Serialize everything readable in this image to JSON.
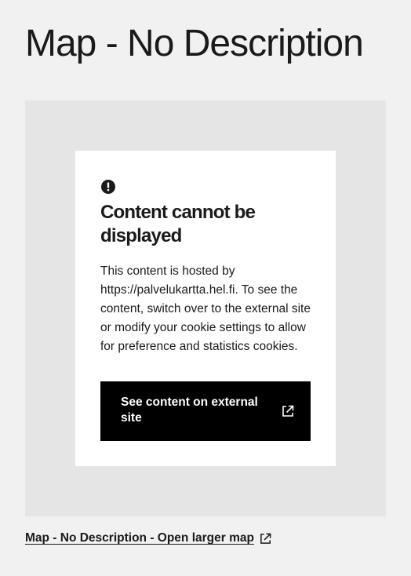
{
  "page": {
    "title": "Map - No Description"
  },
  "embed_notice": {
    "icon": "alert-circle-icon",
    "heading": "Content cannot be displayed",
    "body": "This content is hosted by https://palvelukartta.hel.fi. To see the content, switch over to the external site or modify your cookie settings to allow for preference and statistics cookies.",
    "button_label": "See content on external site",
    "button_icon": "external-link-icon"
  },
  "larger_map_link": {
    "label": "Map - No Description - Open larger map",
    "icon": "external-link-icon"
  },
  "colors": {
    "page_background": "#f1f1f1",
    "frame_background": "#e5e5e5",
    "card_background": "#ffffff",
    "button_background": "#000000",
    "text": "#1a1a1a"
  }
}
